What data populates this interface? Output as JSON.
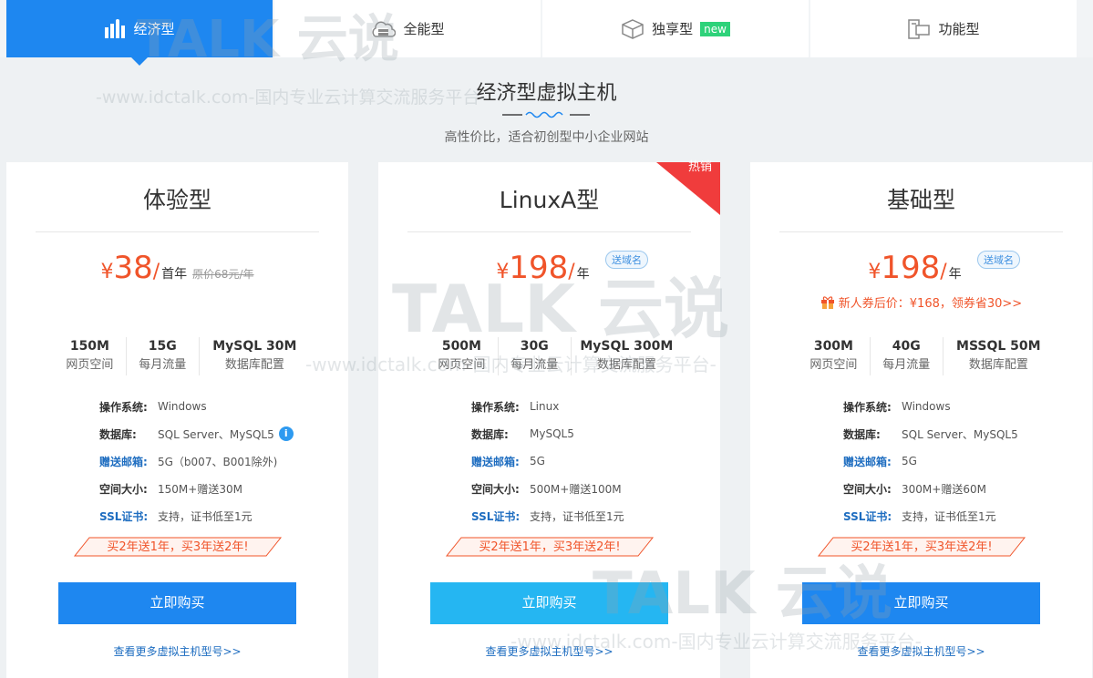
{
  "tabs": [
    {
      "label": "经济型",
      "icon": "bar-chart-icon",
      "active": true
    },
    {
      "label": "全能型",
      "icon": "cloud-server-icon"
    },
    {
      "label": "独享型",
      "icon": "cube-icon",
      "badge": "new"
    },
    {
      "label": "功能型",
      "icon": "devices-icon"
    }
  ],
  "heading": {
    "title": "经济型虚拟主机",
    "subtitle": "高性价比，适合初创型中小企业网站"
  },
  "cards": [
    {
      "name": "体验型",
      "currency": "¥",
      "price": "38",
      "unit": "首年",
      "original": "原价68元/年",
      "specs": [
        {
          "value": "150M",
          "label": "网页空间"
        },
        {
          "value": "15G",
          "label": "每月流量"
        },
        {
          "value": "MySQL 30M",
          "label": "数据库配置"
        }
      ],
      "attrs": [
        {
          "key": "操作系统:",
          "value": "Windows"
        },
        {
          "key": "数据库:",
          "value": "SQL Server、MySQL5"
        },
        {
          "key": "赠送邮箱:",
          "value": "5G（b007、B001除外)"
        },
        {
          "key": "空间大小:",
          "value": "150M+赠送30M"
        },
        {
          "key": "SSL证书:",
          "value": "支持，证书低至1元"
        }
      ],
      "ribbon": "买2年送1年，买3年送2年!",
      "buy": "立即购买",
      "more": "查看更多虚拟主机型号>>"
    },
    {
      "name": "LinuxA型",
      "hot": "热销",
      "currency": "¥",
      "price": "198",
      "unit": "年",
      "tag": "送域名",
      "specs": [
        {
          "value": "500M",
          "label": "网页空间"
        },
        {
          "value": "30G",
          "label": "每月流量"
        },
        {
          "value": "MySQL 300M",
          "label": "数据库配置"
        }
      ],
      "attrs": [
        {
          "key": "操作系统:",
          "value": "Linux"
        },
        {
          "key": "数据库:",
          "value": "MySQL5"
        },
        {
          "key": "赠送邮箱:",
          "value": "5G"
        },
        {
          "key": "空间大小:",
          "value": "500M+赠送100M"
        },
        {
          "key": "SSL证书:",
          "value": "支持，证书低至1元"
        }
      ],
      "ribbon": "买2年送1年，买3年送2年!",
      "buy": "立即购买",
      "more": "查看更多虚拟主机型号>>"
    },
    {
      "name": "基础型",
      "currency": "¥",
      "price": "198",
      "unit": "年",
      "tag": "送域名",
      "promo": "新人券后价：¥168，领券省30>>",
      "specs": [
        {
          "value": "300M",
          "label": "网页空间"
        },
        {
          "value": "40G",
          "label": "每月流量"
        },
        {
          "value": "MSSQL 50M",
          "label": "数据库配置"
        }
      ],
      "attrs": [
        {
          "key": "操作系统:",
          "value": "Windows"
        },
        {
          "key": "数据库:",
          "value": "SQL Server、MySQL5"
        },
        {
          "key": "赠送邮箱:",
          "value": "5G"
        },
        {
          "key": "空间大小:",
          "value": "300M+赠送60M"
        },
        {
          "key": "SSL证书:",
          "value": "支持，证书低至1元"
        }
      ],
      "ribbon": "买2年送1年，买3年送2年!",
      "buy": "立即购买",
      "more": "查看更多虚拟主机型号>>"
    }
  ],
  "watermark": {
    "logo": "TALK 云说",
    "url": "-www.idctalk.com-国内专业云计算交流服务平台-"
  },
  "colors": {
    "primary": "#1e87f0",
    "cyan": "#25b6f2",
    "price": "#f0542a",
    "hot": "#f03c3c",
    "new_badge": "#2ed27a"
  }
}
